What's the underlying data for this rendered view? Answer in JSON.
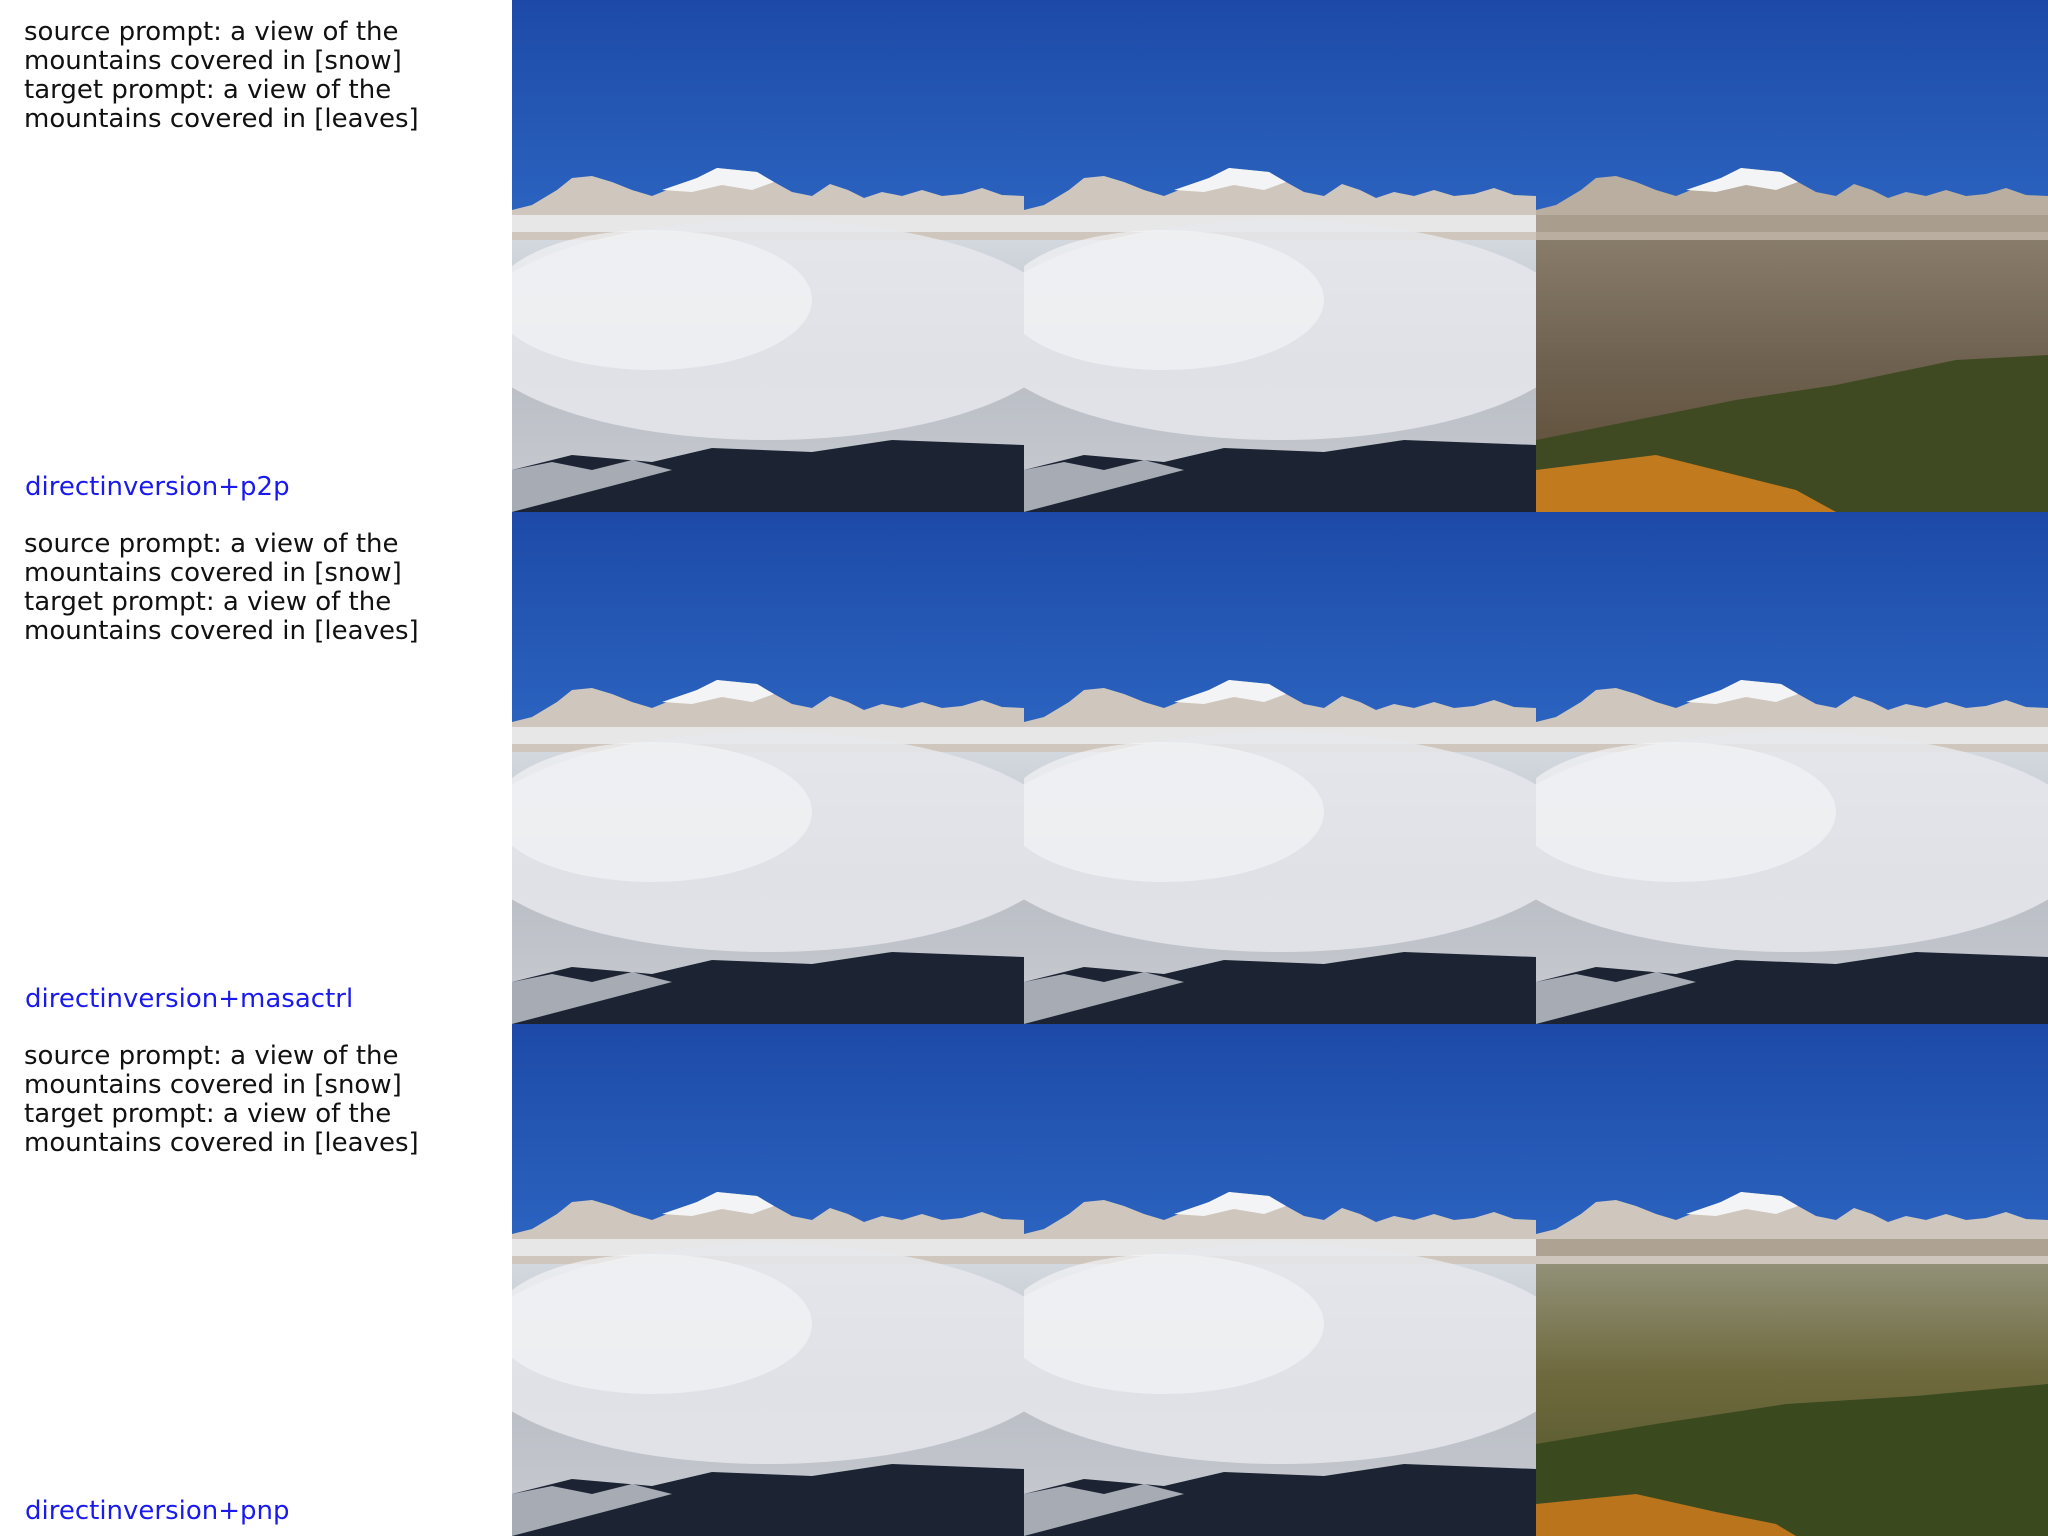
{
  "rows": [
    {
      "prompt": "source prompt: a view of the\nmountains covered in [snow]\ntarget prompt: a view of the\nmountains covered in [leaves]",
      "method": "directinversion+p2p",
      "panels": [
        {
          "scene": "snow"
        },
        {
          "scene": "snow"
        },
        {
          "scene": "leaves-brown"
        }
      ]
    },
    {
      "prompt": "source prompt: a view of the\nmountains covered in [snow]\ntarget prompt: a view of the\nmountains covered in [leaves]",
      "method": "directinversion+masactrl",
      "panels": [
        {
          "scene": "snow"
        },
        {
          "scene": "snow"
        },
        {
          "scene": "snow"
        }
      ]
    },
    {
      "prompt": "source prompt: a view of the\nmountains covered in [snow]\ntarget prompt: a view of the\nmountains covered in [leaves]",
      "method": "directinversion+pnp",
      "panels": [
        {
          "scene": "snow"
        },
        {
          "scene": "snow"
        },
        {
          "scene": "leaves-green"
        }
      ]
    }
  ],
  "colors": {
    "method_label": "#1a1aee",
    "sky_top": "#1d4aa8",
    "sky_bottom": "#3f86e0"
  }
}
